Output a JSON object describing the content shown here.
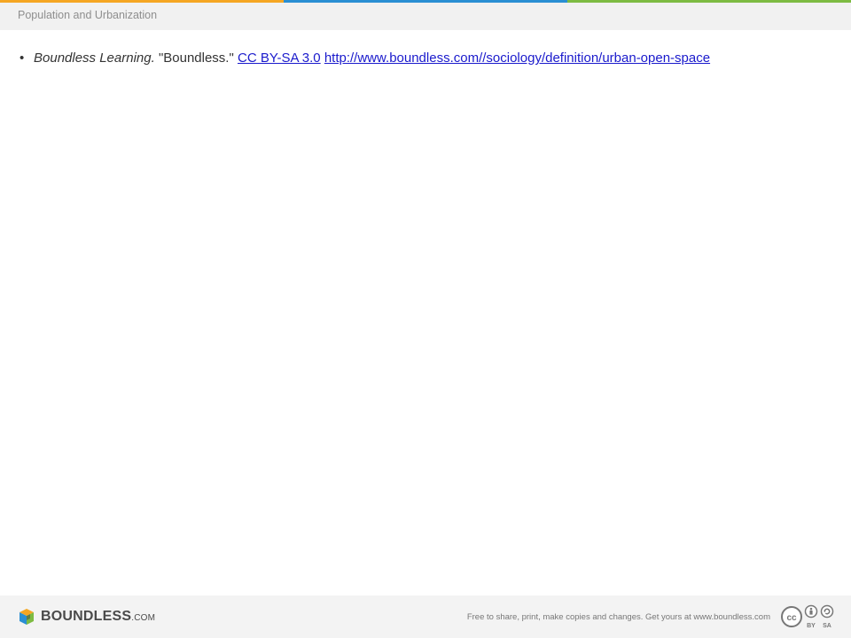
{
  "colors": {
    "accent_bar": [
      "#f5a623",
      "#2a8fd3",
      "#7dbb42"
    ],
    "link": "#1a1acc"
  },
  "header": {
    "title": "Population and Urbanization"
  },
  "citation": {
    "bullet": "•",
    "author": "Boundless Learning.",
    "title": "\"Boundless.\"",
    "license_label": "CC BY-SA 3.0",
    "url": "http://www.boundless.com//sociology/definition/urban-open-space"
  },
  "footer": {
    "logo_word": "BOUNDLESS",
    "logo_suffix": ".COM",
    "text": "Free to share, print, make copies and changes. Get yours at www.boundless.com",
    "license_badge_icon": "cc-by-sa-icon"
  }
}
